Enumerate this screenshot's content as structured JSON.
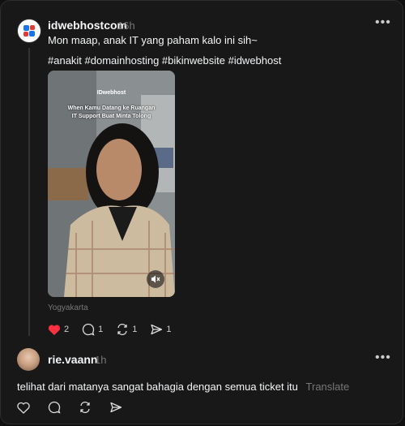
{
  "post": {
    "username": "idwebhostcom",
    "time": "16h",
    "caption": "Mon maap, anak IT yang paham kalo ini sih~",
    "hashtags": "#anakit #domainhosting #bikinwebsite #idwebhost",
    "media": {
      "brand": "IDwebhost",
      "overlay_line1": "When Kamu Datang ke Ruangan",
      "overlay_line2": "IT Support Buat Minta Tolong",
      "muted": true
    },
    "location": "Yogyakarta",
    "likes": "2",
    "replies": "1",
    "reposts": "1",
    "shares": "1",
    "liked": true
  },
  "reply": {
    "username": "rie.vaann",
    "time": "1h",
    "text": "telihat dari matanya sangat bahagia dengan semua ticket itu",
    "translate_label": "Translate"
  },
  "colors": {
    "background": "#181818",
    "liked_heart": "#ff3040",
    "muted_text": "#777777"
  },
  "icons": [
    "more-icon",
    "heart-icon",
    "comment-icon",
    "repost-icon",
    "share-icon",
    "mute-icon"
  ]
}
